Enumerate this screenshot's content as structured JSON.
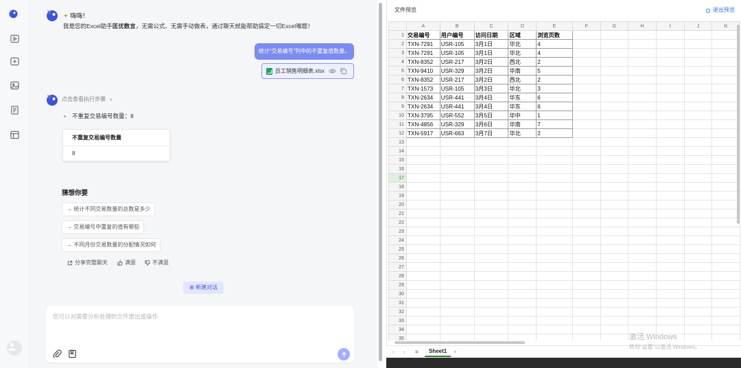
{
  "greeting": {
    "title": "嗨嗨！",
    "line_pre": "我是您的Excel助手",
    "assistant_name": "匡优数言",
    "line_post": "，无需公式、无需手动做表，通过聊天就能帮助搞定一切Excel难题！"
  },
  "user_message": "统计“交易编号”列中的不重复值数量。",
  "attachment": {
    "filename": "员工销售明细表.xlsx"
  },
  "steps_link": "点击查看执行步骤",
  "result": {
    "text": "不重复交易编号数量：8",
    "table_header": "不重复交易编号数量",
    "table_value": "8"
  },
  "suggestions": {
    "title": "猜想你要",
    "items": [
      "→ 统计不同交易数量的总数是多少",
      "→ 交易编号中重复的值有哪些",
      "→ 不同月份交易数量的分配情况如何"
    ]
  },
  "feedback": {
    "share": "分享完整聊天",
    "like": "满意",
    "dislike": "不满意"
  },
  "new_chat_label": "新建对话",
  "input": {
    "placeholder": "您可以对需要分析处理的文件提出或操作"
  },
  "preview": {
    "title": "文件预览",
    "exit_label": "退出预览",
    "columns": [
      "A",
      "B",
      "C",
      "D",
      "E",
      "F",
      "G",
      "H",
      "I",
      "J",
      "K"
    ],
    "headers": [
      "交易编号",
      "用户编号",
      "访问日期",
      "区域",
      "浏览页数"
    ],
    "rows": [
      [
        "TXN-7291",
        "USR-105",
        "3月1日",
        "华北",
        "4"
      ],
      [
        "TXN-7291",
        "USR-105",
        "3月1日",
        "华北",
        "4"
      ],
      [
        "TXN-8352",
        "USR-217",
        "3月2日",
        "西北",
        "2"
      ],
      [
        "TXN-9410",
        "USR-329",
        "3月2日",
        "华南",
        "5"
      ],
      [
        "TXN-8352",
        "USR-217",
        "3月2日",
        "西北",
        "2"
      ],
      [
        "TXN-1573",
        "USR-105",
        "3月3日",
        "华北",
        "3"
      ],
      [
        "TXN-2634",
        "USR-441",
        "3月4日",
        "华东",
        "6"
      ],
      [
        "TXN-2634",
        "USR-441",
        "3月4日",
        "华东",
        "6"
      ],
      [
        "TXN-3795",
        "USR-552",
        "3月5日",
        "华中",
        "1"
      ],
      [
        "TXN-4856",
        "USR-329",
        "3月6日",
        "华南",
        "7"
      ],
      [
        "TXN-5917",
        "USR-663",
        "3月7日",
        "华北",
        "2"
      ]
    ],
    "total_rows": 36,
    "selected_row": 17,
    "sheet_tab": "Sheet1"
  },
  "watermark": {
    "line1": "激活 Windows",
    "line2": "转到“设置”以激活 Windows。"
  },
  "colors": {
    "accent": "#7d8cf1",
    "excel_green": "#21a366",
    "link_blue": "#3b6fe0"
  },
  "icons": [
    "logo-icon",
    "video-icon",
    "add-square-icon",
    "image-icon",
    "document-icon",
    "layout-icon",
    "eye-icon",
    "copy-icon",
    "chevron-right-icon",
    "share-icon",
    "thumbs-up-icon",
    "thumbs-down-icon",
    "paperclip-icon",
    "book-icon",
    "send-arrow-icon",
    "power-icon"
  ]
}
